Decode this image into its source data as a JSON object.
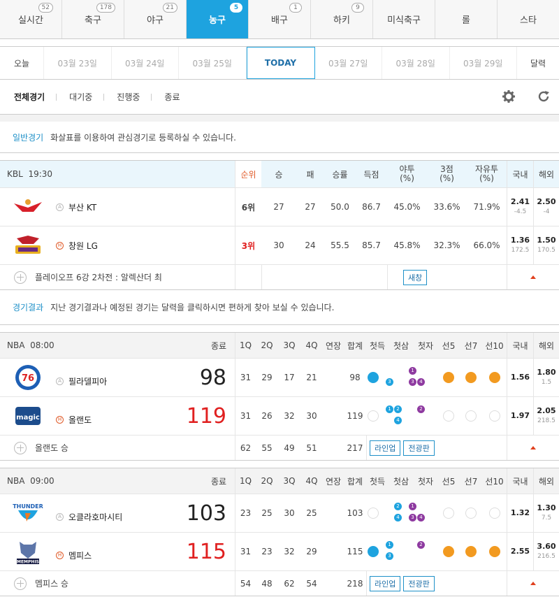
{
  "sports": [
    {
      "label": "실시간",
      "count": "52"
    },
    {
      "label": "축구",
      "count": "178"
    },
    {
      "label": "야구",
      "count": "21"
    },
    {
      "label": "농구",
      "count": "5",
      "active": true
    },
    {
      "label": "배구",
      "count": "1"
    },
    {
      "label": "하키",
      "count": "9"
    },
    {
      "label": "미식축구",
      "count": ""
    },
    {
      "label": "롤",
      "count": ""
    },
    {
      "label": "스타",
      "count": ""
    }
  ],
  "dates": {
    "today_label": "오늘",
    "d23": "03월 23일",
    "d24": "03월 24일",
    "d25": "03월 25일",
    "today": "TODAY",
    "d27": "03월 27일",
    "d28": "03월 28일",
    "d29": "03월 29일",
    "calendar": "달력"
  },
  "filter": {
    "all": "전체경기",
    "waiting": "대기중",
    "playing": "진행중",
    "ended": "종료"
  },
  "notice1": {
    "label": "일반경기",
    "text": "화살표를 이용하여 관심경기로 등록하실 수 있습니다."
  },
  "kbl": {
    "league": "KBL",
    "time": "19:30",
    "headers": {
      "rank": "순위",
      "win": "승",
      "loss": "패",
      "rate": "승률",
      "pts": "득점",
      "fg2": "야투",
      "fg2u": "(%)",
      "fg3": "3점",
      "fg3u": "(%)",
      "ft": "자유투",
      "ftu": "(%)",
      "dom": "국내",
      "ovs": "해외"
    },
    "teams": [
      {
        "name": "부산 KT",
        "mark": "A",
        "rank": "6위",
        "win": "27",
        "loss": "27",
        "rate": "50.0",
        "pts": "86.7",
        "fg2": "45.0%",
        "fg3": "33.6%",
        "ft": "71.9%",
        "dom": "2.41",
        "dom_sub": "-4.5",
        "ovs": "2.50",
        "ovs_sub": "-4"
      },
      {
        "name": "창원 LG",
        "mark": "H",
        "rank": "3위",
        "win": "30",
        "loss": "24",
        "rate": "55.5",
        "pts": "85.7",
        "fg2": "45.8%",
        "fg3": "32.3%",
        "ft": "66.0%",
        "dom": "1.36",
        "dom_sub": "172.5",
        "ovs": "1.50",
        "ovs_sub": "170.5"
      }
    ],
    "footer": "플레이오프 6강 2차전 : 알렉산더 최",
    "window_btn": "새창"
  },
  "notice2": {
    "label": "경기결과",
    "text": "지난 경기결과나 예정된 경기는 달력을 클릭하시면 편하게 찾아 보실 수 있습니다."
  },
  "nba_headers": {
    "status": "종료",
    "q1": "1Q",
    "q2": "2Q",
    "q3": "3Q",
    "q4": "4Q",
    "ot": "연장",
    "total": "합계",
    "first_pt": "첫득",
    "first_3": "첫삼",
    "first_ft": "첫자",
    "to5": "선5",
    "to7": "선7",
    "to10": "선10",
    "dom": "국내",
    "ovs": "해외"
  },
  "nba1": {
    "league": "NBA",
    "time": "08:00",
    "teams": [
      {
        "name": "필라델피아",
        "mark": "A",
        "score": "98",
        "q": [
          "31",
          "29",
          "17",
          "21"
        ],
        "ot": "",
        "total": "98",
        "dom": "1.56",
        "dom_sub": "",
        "ovs": "1.80",
        "ovs_sub": "1.5"
      },
      {
        "name": "올랜도",
        "mark": "H",
        "score": "119",
        "q": [
          "31",
          "26",
          "32",
          "30"
        ],
        "ot": "",
        "total": "119",
        "dom": "1.97",
        "dom_sub": "",
        "ovs": "2.05",
        "ovs_sub": "218.5"
      }
    ],
    "footer": "올랜도 승",
    "totals": [
      "62",
      "55",
      "49",
      "51"
    ],
    "total_ot": "",
    "total_sum": "217",
    "btn_lineup": "라인업",
    "btn_record": "전광판"
  },
  "nba2": {
    "league": "NBA",
    "time": "09:00",
    "teams": [
      {
        "name": "오클라호마시티",
        "mark": "A",
        "score": "103",
        "q": [
          "23",
          "25",
          "30",
          "25"
        ],
        "ot": "",
        "total": "103",
        "dom": "1.32",
        "dom_sub": "",
        "ovs": "1.30",
        "ovs_sub": "7.5"
      },
      {
        "name": "멤피스",
        "mark": "H",
        "score": "115",
        "q": [
          "31",
          "23",
          "32",
          "29"
        ],
        "ot": "",
        "total": "115",
        "dom": "2.55",
        "dom_sub": "",
        "ovs": "3.60",
        "ovs_sub": "216.5"
      }
    ],
    "footer": "멤피스 승",
    "totals": [
      "54",
      "48",
      "62",
      "54"
    ],
    "total_ot": "",
    "total_sum": "218",
    "btn_lineup": "라인업",
    "btn_record": "전광판"
  }
}
